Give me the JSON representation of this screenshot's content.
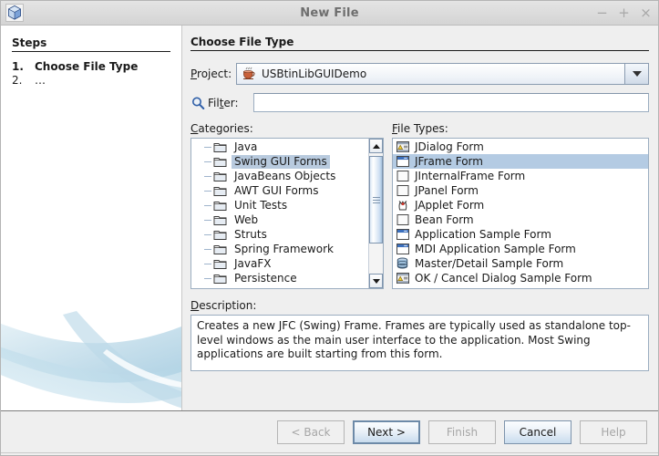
{
  "window": {
    "title": "New File",
    "icon": "cube-icon",
    "controls": {
      "minimize": "−",
      "maximize": "+",
      "close": "×"
    }
  },
  "steps": {
    "title": "Steps",
    "items": [
      {
        "num": "1.",
        "label": "Choose File Type",
        "current": true
      },
      {
        "num": "2.",
        "label": "…",
        "current": false
      }
    ]
  },
  "content": {
    "title": "Choose File Type",
    "project": {
      "label": "Project:",
      "mnemonic": "P",
      "icon": "java-coffee-cup-icon",
      "value": "USBtinLibGUIDemo",
      "arrow_icon": "chevron-down-icon"
    },
    "filter": {
      "icon": "search-icon",
      "label_before": "Fil",
      "label_mnemonic": "t",
      "label_after": "er:",
      "value": "",
      "placeholder": ""
    },
    "categories": {
      "caption": "Categories:",
      "caption_mnemonic": "C",
      "selected": "Swing GUI Forms",
      "items": [
        {
          "label": "Java",
          "icon": "folder-icon",
          "selected": false
        },
        {
          "label": "Swing GUI Forms",
          "icon": "folder-icon",
          "selected": true
        },
        {
          "label": "JavaBeans Objects",
          "icon": "folder-icon",
          "selected": false
        },
        {
          "label": "AWT GUI Forms",
          "icon": "folder-icon",
          "selected": false
        },
        {
          "label": "Unit Tests",
          "icon": "folder-icon",
          "selected": false
        },
        {
          "label": "Web",
          "icon": "folder-icon",
          "selected": false
        },
        {
          "label": "Struts",
          "icon": "folder-icon",
          "selected": false
        },
        {
          "label": "Spring Framework",
          "icon": "folder-icon",
          "selected": false
        },
        {
          "label": "JavaFX",
          "icon": "folder-icon",
          "selected": false
        },
        {
          "label": "Persistence",
          "icon": "folder-icon",
          "selected": false
        }
      ],
      "scrollbar": {
        "up_icon": "triangle-up-icon",
        "down_icon": "triangle-down-icon"
      }
    },
    "file_types": {
      "caption": "File Types:",
      "caption_mnemonic": "F",
      "selected": "JFrame Form",
      "items": [
        {
          "label": "JDialog Form",
          "icon": "dialog-form-icon",
          "selected": false
        },
        {
          "label": "JFrame Form",
          "icon": "frame-form-icon",
          "selected": true
        },
        {
          "label": "JInternalFrame Form",
          "icon": "internal-frame-icon",
          "selected": false
        },
        {
          "label": "JPanel Form",
          "icon": "panel-form-icon",
          "selected": false
        },
        {
          "label": "JApplet Form",
          "icon": "applet-form-icon",
          "selected": false
        },
        {
          "label": "Bean Form",
          "icon": "bean-form-icon",
          "selected": false
        },
        {
          "label": "Application Sample Form",
          "icon": "application-sample-icon",
          "selected": false
        },
        {
          "label": "MDI Application Sample Form",
          "icon": "mdi-application-icon",
          "selected": false
        },
        {
          "label": "Master/Detail Sample Form",
          "icon": "database-icon",
          "selected": false
        },
        {
          "label": "OK / Cancel Dialog Sample Form",
          "icon": "dialog-form-icon",
          "selected": false
        }
      ]
    },
    "description": {
      "caption": "Description:",
      "caption_mnemonic": "D",
      "text": "Creates a new JFC (Swing) Frame. Frames are typically used as standalone top-level windows as the main user interface to the application. Most Swing applications are built starting from this form."
    }
  },
  "buttons": [
    {
      "label": "< Back",
      "enabled": false,
      "focused": false,
      "name": "back-button"
    },
    {
      "label": "Next >",
      "enabled": true,
      "focused": true,
      "name": "next-button"
    },
    {
      "label": "Finish",
      "enabled": false,
      "focused": false,
      "name": "finish-button"
    },
    {
      "label": "Cancel",
      "enabled": true,
      "focused": false,
      "name": "cancel-button"
    },
    {
      "label": "Help",
      "enabled": false,
      "focused": false,
      "name": "help-button"
    }
  ],
  "colors": {
    "selection_blue": "#b4cbe3",
    "selection_gray_blue": "#b8cade",
    "panel_gray": "#efefef",
    "swoosh_blue": "#bcd9e8"
  }
}
